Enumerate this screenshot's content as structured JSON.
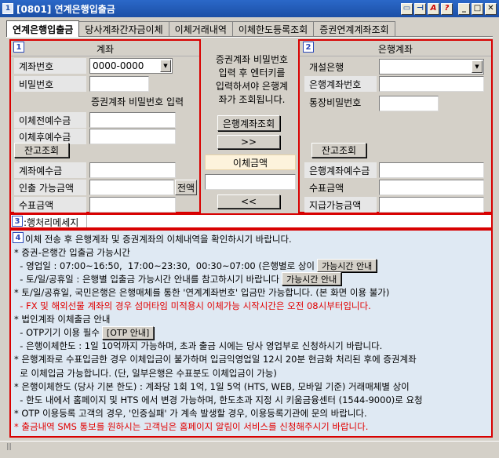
{
  "window": {
    "title": "[0801] 연계은행입출금",
    "app_icon": "window-app-icon",
    "title_buttons": [
      "screen-icon",
      "pin-icon",
      "font-icon",
      "help-icon",
      "minimize-icon",
      "maximize-icon",
      "close-icon"
    ]
  },
  "tabs": [
    {
      "label": "연계은행입출금",
      "active": true
    },
    {
      "label": "당사계좌간자금이체",
      "active": false
    },
    {
      "label": "이체거래내역",
      "active": false
    },
    {
      "label": "이체한도등록조회",
      "active": false
    },
    {
      "label": "증권연계계좌조회",
      "active": false
    }
  ],
  "left": {
    "number": "1",
    "header": "계좌",
    "account_no_label": "계좌번호",
    "account_no_value": "0000-0000",
    "password_label": "비밀번호",
    "password_hint": "증권계좌 비밀번호 입력",
    "before_deposit_label": "이체전예수금",
    "after_deposit_label": "이체후예수금",
    "balance_button": "잔고조회",
    "account_deposit_label": "계좌예수금",
    "withdraw_amount_label": "인출 가능금액",
    "all_button": "전액",
    "check_amount_label": "수표금액"
  },
  "middle": {
    "instruction": "증권계좌 비밀번호\n입력 후 엔터키를\n입력하셔야 은행계\n좌가 조회됩니다.",
    "bank_query_button": "은행계좌조회",
    "to_bank_button": ">>",
    "transfer_amount_label": "이체금액",
    "to_securities_button": "<<"
  },
  "right": {
    "number": "2",
    "header": "은행계좌",
    "open_bank_label": "개설은행",
    "bank_account_label": "은행계좌번호",
    "bank_password_label": "통장비밀번호",
    "balance_button": "잔고조회",
    "bank_deposit_label": "은행계좌예수금",
    "check_amount_label": "수표금액",
    "payable_amount_label": "지급가능금액"
  },
  "message": {
    "number": "3",
    "label": ":행처리메세지"
  },
  "notice": {
    "number": "4",
    "lines": [
      {
        "text": "이체 전송 후 은행계좌 및 증권계좌의 이체내역을 확인하시기 바랍니다.",
        "red": false
      },
      {
        "text": "* 증권-은행간 입출금 가능시간",
        "red": false
      },
      {
        "text": "  - 영업일 : 07:00~16:50,  17:00~23:30,  00:30~07:00 (은행별로 상이",
        "red": false,
        "button": "가능시간 안내"
      },
      {
        "text": "  - 토/일/공휴일 : 은행별 입출금 가능시간 안내를 참고하시기 바랍니다",
        "red": false,
        "button": "가능시간 안내"
      },
      {
        "text": "* 토/일/공휴일, 국민은행은 은행매체를 통한 '연계계좌번호' 입금만 가능합니다. (본 화면 이용 불가)",
        "red": false
      },
      {
        "text": "  - FX 및 해외선물 계좌의 경우 섬머타임 미적용시 이체가능 시작시간은 오전 08시부터입니다.",
        "red": true
      },
      {
        "text": "* 법인계좌 이체출금 안내",
        "red": false
      },
      {
        "text": "  - OTP기기 이용 필수",
        "red": false,
        "button": "[OTP 안내]"
      },
      {
        "text": "  - 은행이체한도 : 1일 10억까지 가능하며, 초과 출금 시에는 당사 영업부로 신청하시기 바랍니다.",
        "red": false
      },
      {
        "text": "* 은행계좌로 수표입금한 경우 이체입금이 불가하며 입금익영업일 12시 20분 현금화 처리된 후에 증권계좌",
        "red": false
      },
      {
        "text": "  로 이체입금 가능합니다. (단, 일부은행은 수표분도 이체입금이 가능)",
        "red": false
      },
      {
        "text": "* 은행이체한도 (당사 기본 한도) : 계좌당 1회 1억, 1일 5억 (HTS, WEB, 모바일 기준) 거래매체별 상이",
        "red": false
      },
      {
        "text": "  - 한도 내에서 홈페이지 및 HTS 에서 변경 가능하며, 한도초과 지정 시 키움금융센터 (1544-9000)로 요청",
        "red": false
      },
      {
        "text": "* OTP 이용등록 고객의 경우, '인증실패' 가 계속 발생할 경우, 이용등록기관에 문의 바랍니다.",
        "red": false
      },
      {
        "text": "* 출금내역 SMS 통보를 원하시는 고객님은 홈페이지 알림이 서비스를 신청해주시기 바랍니다.",
        "red": true
      }
    ]
  },
  "colors": {
    "panel_border": "#d80000",
    "notice_bg": "#dfe9f3",
    "title_bar": "#2b68c8",
    "red_text": "#e00000"
  }
}
